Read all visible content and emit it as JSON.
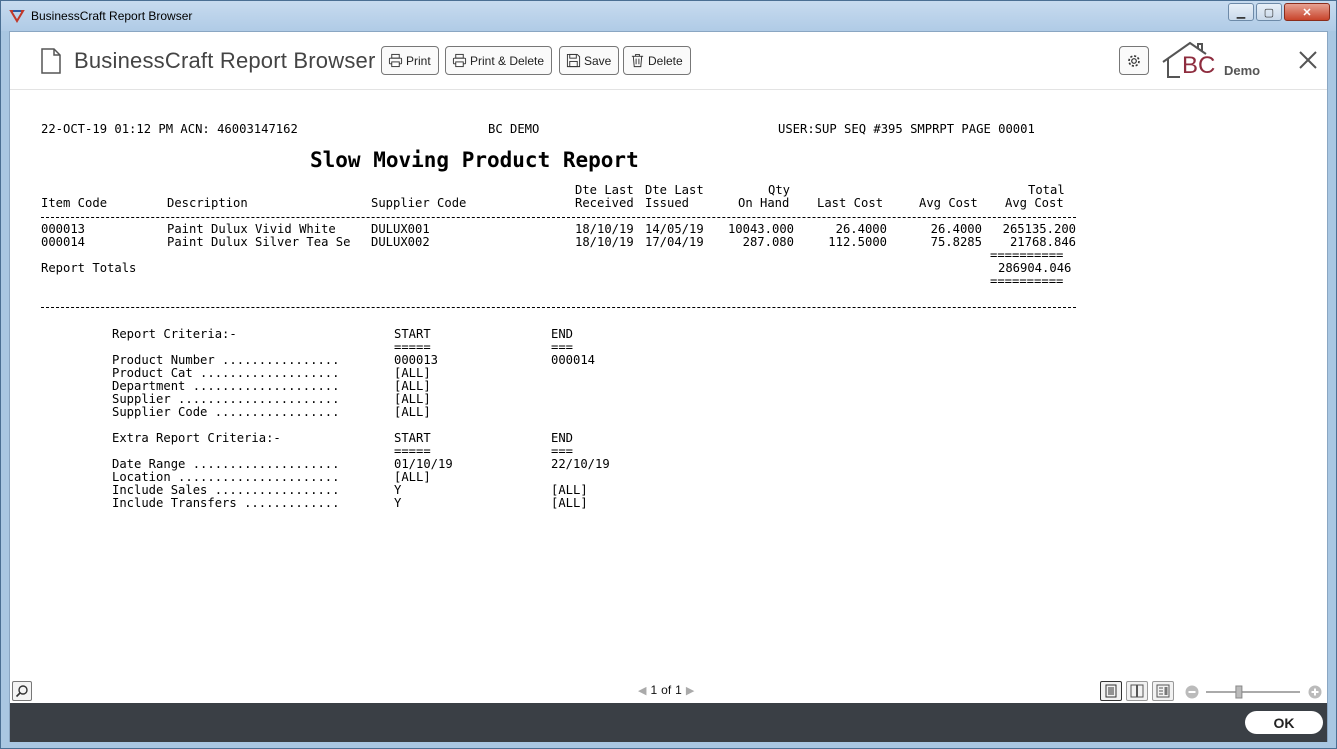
{
  "window": {
    "title": "BusinessCraft Report Browser",
    "controls": [
      "minimize",
      "maximize",
      "close"
    ]
  },
  "toolbar": {
    "app_title": "BusinessCraft Report Browser",
    "print_label": "Print",
    "print_delete_label": "Print & Delete",
    "save_label": "Save",
    "delete_label": "Delete",
    "logo_text": "BC",
    "demo_label": "Demo"
  },
  "report": {
    "header_left": "22-OCT-19 01:12 PM ACN: 46003147162",
    "header_center": "BC DEMO",
    "header_right": "USER:SUP SEQ #395 SMPRPT PAGE 00001",
    "title": "Slow Moving Product Report",
    "columns_line1": "                                                    Dte Last Dte Last        Qty                            Total",
    "columns_line2": "Item Code        Description                Supplier Code              Received Issued      On Hand    Last Cost     Avg Cost    Avg Cost",
    "separator": "-----------------------------------------------------------------------------------------------------------------------------------",
    "rows": [
      {
        "item_code": "000013",
        "description": "Paint Dulux Vivid White",
        "supplier_code": "DULUX001",
        "dte_last_received": "18/10/19",
        "dte_last_issued": "14/05/19",
        "qty_on_hand": "10043.000",
        "last_cost": "26.4000",
        "avg_cost": "26.4000",
        "total_avg_cost": "265135.200"
      },
      {
        "item_code": "000014",
        "description": "Paint Dulux Silver Tea Se",
        "supplier_code": "DULUX002",
        "dte_last_received": "18/10/19",
        "dte_last_issued": "17/04/19",
        "qty_on_hand": "287.080",
        "last_cost": "112.5000",
        "avg_cost": "75.8285",
        "total_avg_cost": "21768.846"
      }
    ],
    "double_rule": "==========",
    "totals_label": "Report Totals",
    "totals_value": "286904.046",
    "criteria": {
      "heading": "Report Criteria:-",
      "start_label": "START",
      "end_label": "END",
      "start_rule": "=====",
      "end_rule": "===",
      "items": [
        {
          "label": "Product Number ................",
          "start": "000013",
          "end": "000014"
        },
        {
          "label": "Product Cat ...................",
          "start": "[ALL]",
          "end": ""
        },
        {
          "label": "Department ....................",
          "start": "[ALL]",
          "end": ""
        },
        {
          "label": "Supplier ......................",
          "start": "[ALL]",
          "end": ""
        },
        {
          "label": "Supplier Code .................",
          "start": "[ALL]",
          "end": ""
        }
      ]
    },
    "extra_criteria": {
      "heading": "Extra Report Criteria:-",
      "start_label": "START",
      "end_label": "END",
      "start_rule": "=====",
      "end_rule": "===",
      "items": [
        {
          "label": "Date Range ....................",
          "start": "01/10/19",
          "end": "22/10/19"
        },
        {
          "label": "Location ......................",
          "start": "[ALL]",
          "end": ""
        },
        {
          "label": "Include Sales .................",
          "start": "Y",
          "end": "[ALL]"
        },
        {
          "label": "Include Transfers .............",
          "start": "Y",
          "end": "[ALL]"
        }
      ]
    }
  },
  "status": {
    "current_page": "1",
    "of_label": "of",
    "total_pages": "1",
    "zoom_fraction": 0.35
  },
  "footer": {
    "ok_label": "OK"
  }
}
